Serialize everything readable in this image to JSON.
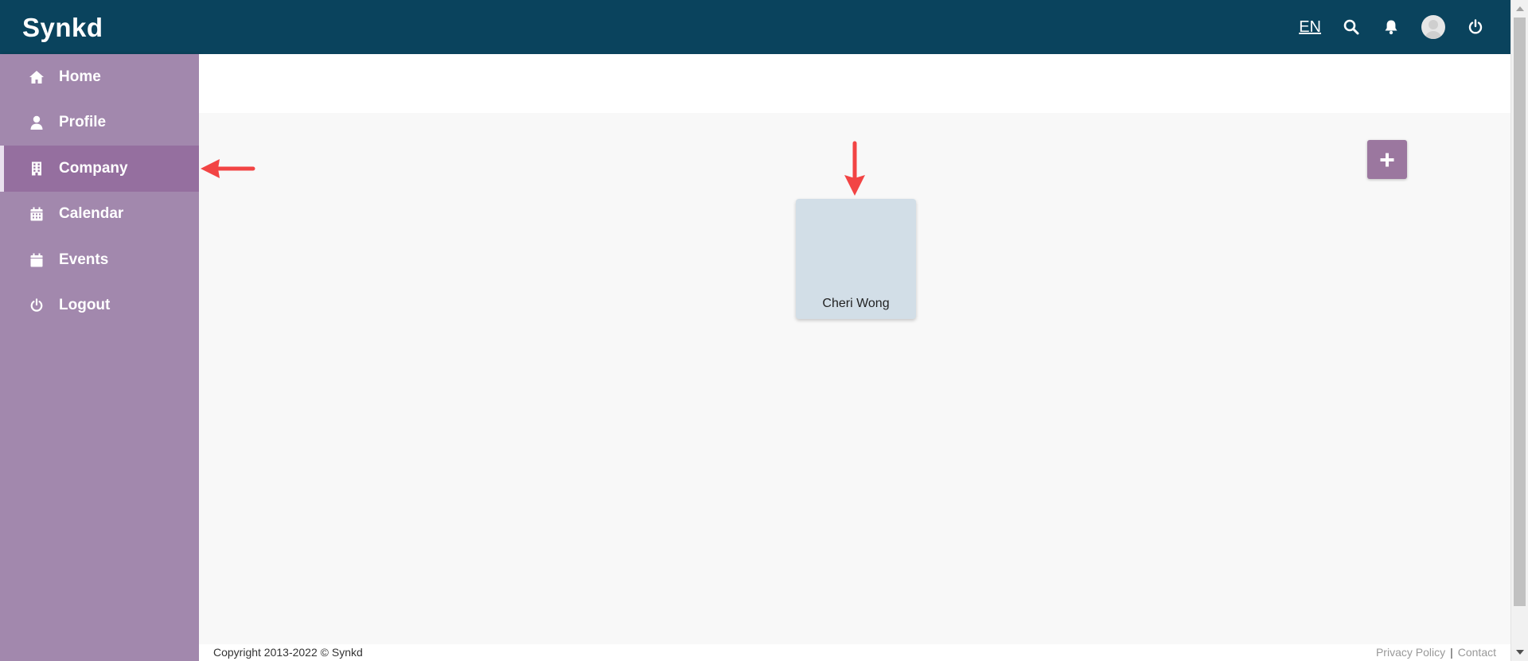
{
  "app": {
    "logo_text": "Synkd",
    "brand_color": "#0a435d",
    "accent_color": "#a288ad"
  },
  "topbar": {
    "language": "EN",
    "icons": [
      "search-icon",
      "bell-icon",
      "avatar",
      "power-icon"
    ]
  },
  "sidebar": {
    "items": [
      {
        "label": "Home",
        "icon": "home-icon",
        "active": false
      },
      {
        "label": "Profile",
        "icon": "user-icon",
        "active": false
      },
      {
        "label": "Company",
        "icon": "building-icon",
        "active": true
      },
      {
        "label": "Calendar",
        "icon": "calendar-icon",
        "active": false
      },
      {
        "label": "Events",
        "icon": "calendar-icon",
        "active": false
      },
      {
        "label": "Logout",
        "icon": "power-icon",
        "active": false
      }
    ]
  },
  "main": {
    "add_label": "+",
    "cards": [
      {
        "name": "Cheri Wong"
      }
    ]
  },
  "footer": {
    "copyright": "Copyright 2013-2022 © Synkd",
    "privacy": "Privacy Policy",
    "separator": "|",
    "contact": "Contact"
  }
}
